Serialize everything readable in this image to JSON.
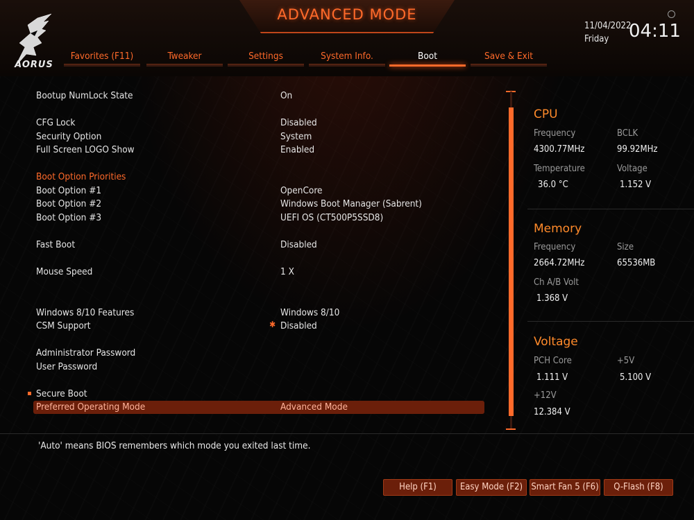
{
  "header": {
    "title": "ADVANCED MODE",
    "logo_text": "AORUS",
    "date": "11/04/2022",
    "day": "Friday",
    "time": "04:11"
  },
  "tabs": [
    {
      "label": "Favorites (F11)"
    },
    {
      "label": "Tweaker"
    },
    {
      "label": "Settings"
    },
    {
      "label": "System Info."
    },
    {
      "label": "Boot",
      "active": true
    },
    {
      "label": "Save & Exit"
    }
  ],
  "settings": {
    "bootup_numlock": {
      "label": "Bootup NumLock State",
      "value": "On"
    },
    "cfg_lock": {
      "label": "CFG Lock",
      "value": "Disabled"
    },
    "security_option": {
      "label": "Security Option",
      "value": "System"
    },
    "full_screen_logo": {
      "label": "Full Screen LOGO Show",
      "value": "Enabled"
    },
    "boot_priorities_header": {
      "label": "Boot Option Priorities"
    },
    "boot_option_1": {
      "label": "Boot Option #1",
      "value": "OpenCore"
    },
    "boot_option_2": {
      "label": "Boot Option #2",
      "value": "Windows Boot Manager (Sabrent)"
    },
    "boot_option_3": {
      "label": "Boot Option #3",
      "value": "UEFI OS (CT500P5SSD8)"
    },
    "fast_boot": {
      "label": "Fast Boot",
      "value": "Disabled"
    },
    "mouse_speed": {
      "label": "Mouse Speed",
      "value": "1 X"
    },
    "win_features": {
      "label": "Windows 8/10 Features",
      "value": "Windows 8/10"
    },
    "csm_support": {
      "label": "CSM Support",
      "value": "Disabled"
    },
    "admin_password": {
      "label": "Administrator Password"
    },
    "user_password": {
      "label": "User Password"
    },
    "secure_boot": {
      "label": "Secure Boot"
    },
    "preferred_mode": {
      "label": "Preferred Operating Mode",
      "value": "Advanced Mode"
    }
  },
  "cpu": {
    "title": "CPU",
    "freq_label": "Frequency",
    "freq_value": "4300.77MHz",
    "bclk_label": "BCLK",
    "bclk_value": "99.92MHz",
    "temp_label": "Temperature",
    "temp_value": "36.0 °C",
    "volt_label": "Voltage",
    "volt_value": "1.152 V"
  },
  "memory": {
    "title": "Memory",
    "freq_label": "Frequency",
    "freq_value": "2664.72MHz",
    "size_label": "Size",
    "size_value": "65536MB",
    "chvolt_label": "Ch A/B Volt",
    "chvolt_value": "1.368 V"
  },
  "voltage": {
    "title": "Voltage",
    "pch_label": "PCH Core",
    "pch_value": "1.111 V",
    "p5v_label": "+5V",
    "p5v_value": "5.100 V",
    "p12v_label": "+12V",
    "p12v_value": "12.384 V"
  },
  "footer": {
    "help_text": "'Auto' means BIOS remembers which mode you exited last time.",
    "buttons": [
      "Help (F1)",
      "Easy Mode (F2)",
      "Smart Fan 5 (F6)",
      "Q-Flash (F8)"
    ]
  },
  "colors": {
    "accent": "#ff6a2a",
    "highlight_row": "#6b1f0a",
    "background": "#060606"
  }
}
